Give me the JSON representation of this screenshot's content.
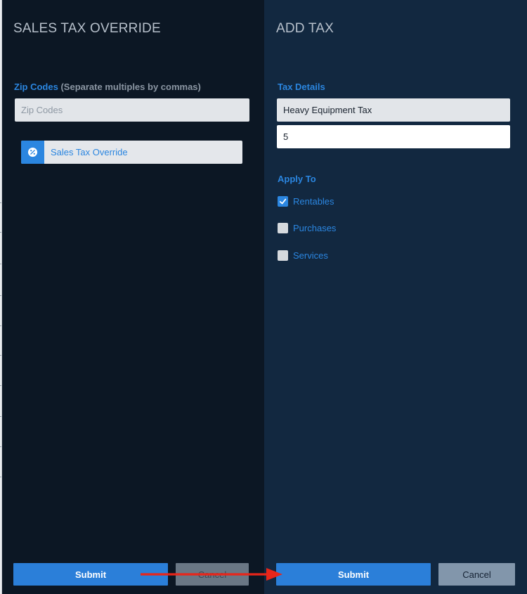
{
  "left_panel": {
    "title": "SALES TAX OVERRIDE",
    "zip_label": "Zip Codes",
    "zip_hint": "(Separate multiples by commas)",
    "zip_value": "",
    "zip_placeholder": "Zip Codes",
    "override_item": {
      "icon": "percent-badge-icon",
      "label": "Sales Tax Override"
    },
    "submit_label": "Submit",
    "cancel_label": "Cancel"
  },
  "right_panel": {
    "title": "ADD TAX",
    "details_label": "Tax Details",
    "tax_name_value": "Heavy Equipment Tax",
    "tax_rate_value": "5",
    "apply_label": "Apply To",
    "options": [
      {
        "label": "Rentables",
        "checked": true
      },
      {
        "label": "Purchases",
        "checked": false
      },
      {
        "label": "Services",
        "checked": false
      }
    ],
    "submit_label": "Submit",
    "cancel_label": "Cancel"
  },
  "annotation": {
    "type": "arrow",
    "color": "#e8261a"
  },
  "colors": {
    "left_panel_bg": "#0c1724",
    "right_panel_bg": "#122840",
    "accent": "#2b86e0",
    "submit_bg": "#2b7fd9",
    "cancel_bg": "#8296ab"
  }
}
